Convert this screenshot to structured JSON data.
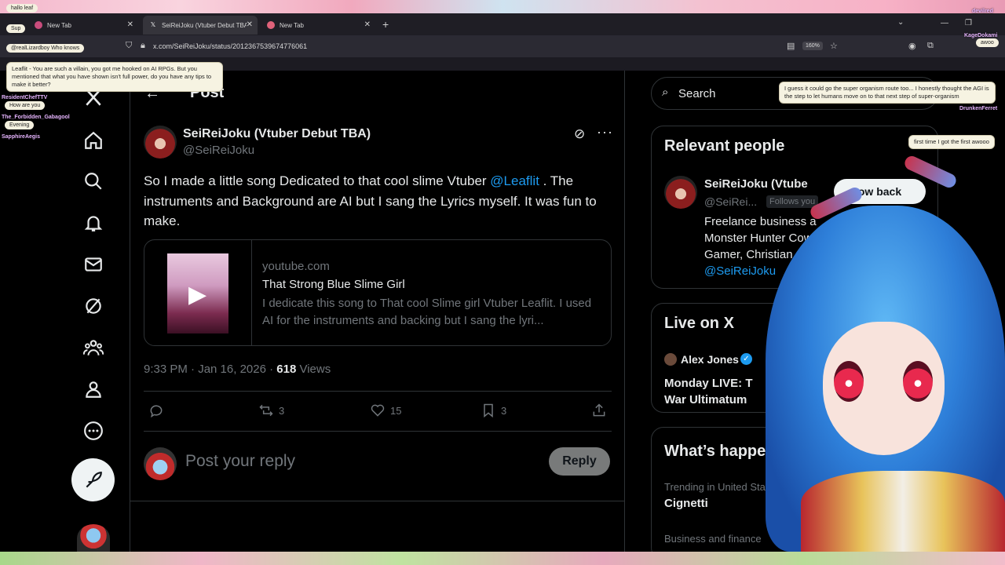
{
  "browser": {
    "tabs": [
      {
        "label": "New Tab",
        "active": false
      },
      {
        "label": "SeiReiJoku (Vtuber Debut TBA)",
        "active": true
      },
      {
        "label": "New Tab",
        "active": false
      }
    ],
    "url": "x.com/SeiReiJoku/status/2012367539674776061",
    "zoom": "160%"
  },
  "header": {
    "title": "Post"
  },
  "post": {
    "author_name": "SeiReiJoku (Vtuber Debut TBA)",
    "author_handle": "@SeiReiJoku",
    "text_before": "So I made a little song Dedicated to that cool slime Vtuber ",
    "mention": "@Leaflit",
    "text_after": " . The instruments and Background are AI but I sang the Lyrics myself. It was fun to make.",
    "card": {
      "domain": "youtube.com",
      "title": "That Strong Blue Slime Girl",
      "description": "I dedicate this song to That cool Slime girl Vtuber Leaflit. I used AI for the instruments and backing but I sang the lyri..."
    },
    "time": "9:33 PM · Jan 16, 2026 · ",
    "views_count": "618",
    "views_label": " Views",
    "replies": "",
    "reposts": "3",
    "likes": "15",
    "bookmarks": "3"
  },
  "reply": {
    "placeholder": "Post your reply",
    "button": "Reply"
  },
  "sidebar": {
    "search_placeholder": "Search",
    "relevant_title": "Relevant people",
    "relevant_name": "SeiReiJoku (Vtube",
    "relevant_handle": "@SeiRei...",
    "follows_you": "Follows you",
    "follow_back": "ow back",
    "bio_1": "Freelance business a",
    "bio_2": "Monster Hunter Cow",
    "bio_3": "Gamer, Christian",
    "bio_link": "@SeiReiJoku",
    "live_title": "Live on X",
    "live_name": "Alex Jones",
    "live_line_1": "Monday LIVE: T",
    "live_line_2": "War Ultimatum",
    "happening_title": "What’s happenin",
    "trend1_cat": "Trending in United States",
    "trend1_name": "Cignetti",
    "trend2_cat": "Business and finance"
  },
  "overlay": {
    "chat": [
      {
        "name": "",
        "msg": "hallo leaf"
      },
      {
        "name": "",
        "msg": "Sup"
      },
      {
        "name": "",
        "msg": "@realLizardboy Who knows"
      },
      {
        "name": "ResidentChefTTV",
        "msg": "How are you"
      },
      {
        "name": "The_Forbidden_Gabagool",
        "msg": "Evening"
      },
      {
        "name": "SapphireAegis",
        "msg": ""
      }
    ],
    "callout_left": "Leaflit - You are such a villain, you got me hooked on AI RPGs. But you mentioned that what you have shown isn't full power, do you have any tips to make it better?",
    "callout_right_1": "I guess it could go the super organism route too... I honestly thought the AGI is the step to let humans move on to that next step of super-organism",
    "callout_right_2": "first time I got the first awooo",
    "right_chat": [
      {
        "name": "devilred",
        "msg": ""
      },
      {
        "name": "KageDokami",
        "msg": "awoo"
      },
      {
        "name": "DrunkenFerret",
        "msg": ""
      }
    ]
  },
  "colors": {
    "accent": "#1d9bf0",
    "background": "#000000",
    "muted": "#71767b",
    "border": "#2f3336"
  }
}
